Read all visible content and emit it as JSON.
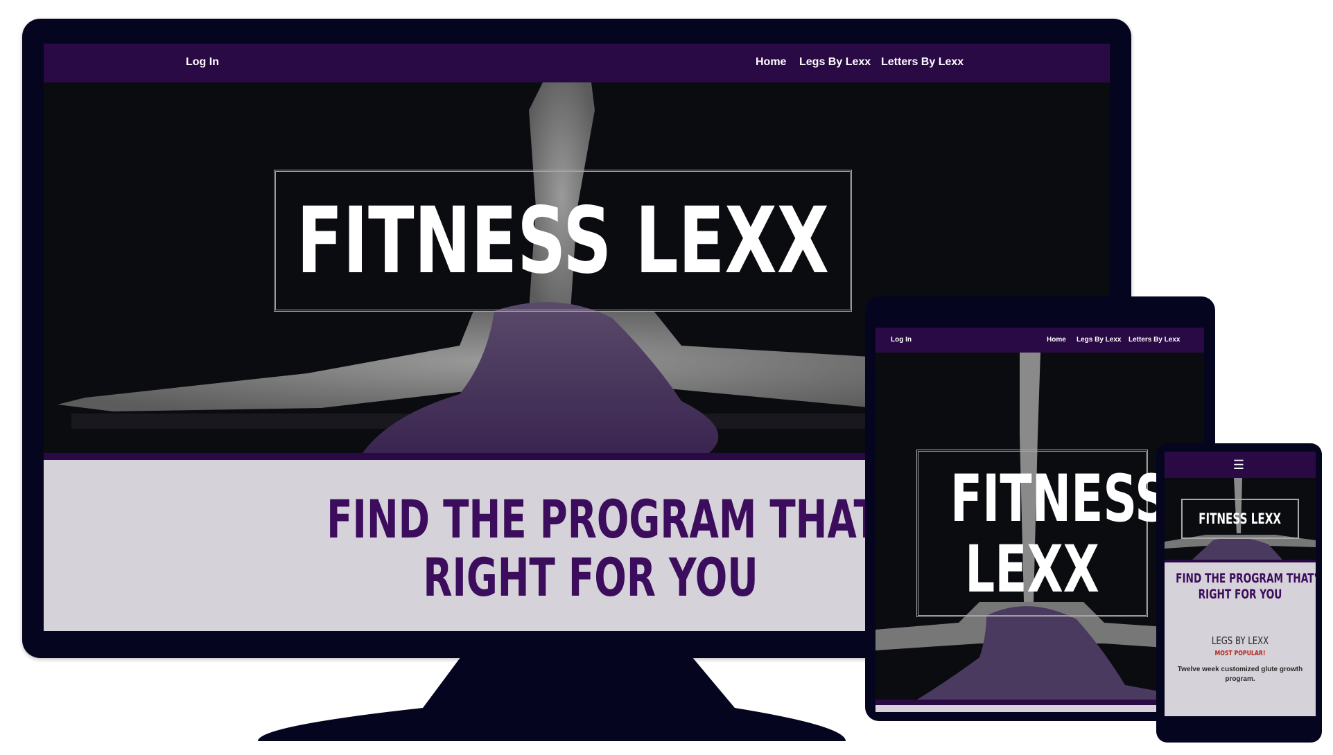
{
  "colors": {
    "nav_bg": "#2a0a45",
    "heading": "#3b0d5c",
    "section_bg": "#d6d2d9",
    "device_frame": "#050520",
    "badge": "#b3261e"
  },
  "desktop": {
    "nav": {
      "login": "Log In",
      "home": "Home",
      "legs": "Legs By Lexx",
      "letters": "Letters By Lexx"
    },
    "hero": {
      "title": "FITNESS LEXX"
    },
    "section": {
      "heading_line1": "FIND THE PROGRAM THAT'S",
      "heading_line2": "RIGHT FOR YOU"
    }
  },
  "tablet": {
    "nav": {
      "login": "Log In",
      "home": "Home",
      "legs": "Legs By Lexx",
      "letters": "Letters By Lexx"
    },
    "hero": {
      "title_line1": "FITNESS",
      "title_line2": "LEXX"
    }
  },
  "phone": {
    "menu_icon": "hamburger-menu-icon",
    "hero": {
      "title": "FITNESS LEXX"
    },
    "section": {
      "heading_line1": "FIND THE PROGRAM THAT'S",
      "heading_line2": "RIGHT FOR YOU",
      "card_title": "LEGS BY LEXX",
      "badge": "MOST POPULAR!",
      "description": "Twelve week customized glute growth program."
    }
  }
}
